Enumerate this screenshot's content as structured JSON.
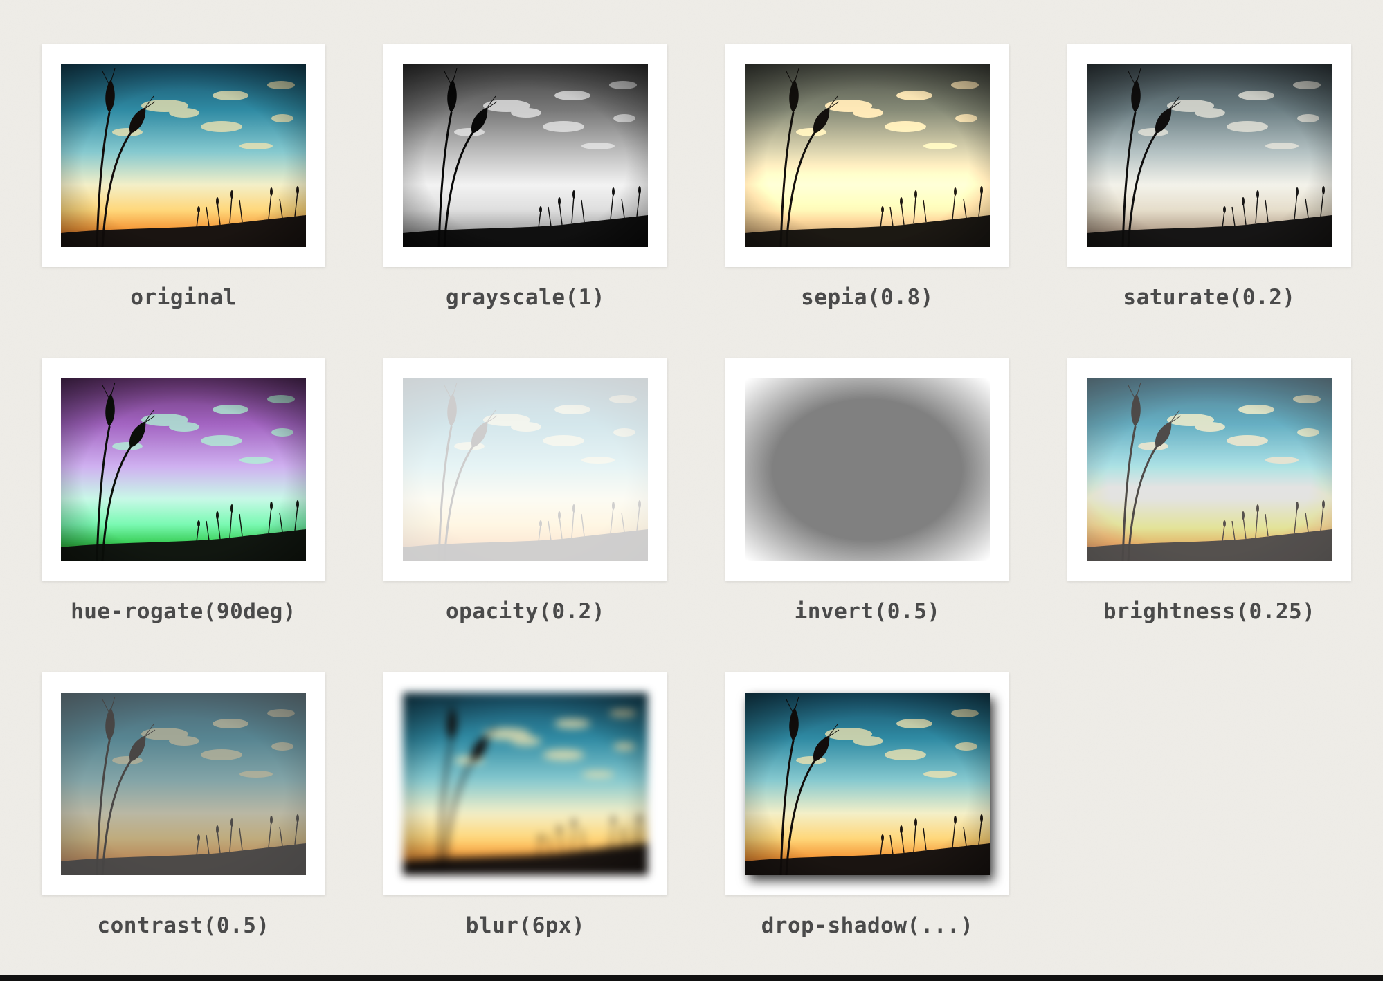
{
  "gallery": {
    "items": [
      {
        "label": "original",
        "filter": "none"
      },
      {
        "label": "grayscale(1)",
        "filter": "grayscale"
      },
      {
        "label": "sepia(0.8)",
        "filter": "sepia"
      },
      {
        "label": "saturate(0.2)",
        "filter": "saturate"
      },
      {
        "label": "hue-rogate(90deg)",
        "filter": "hue-rotate"
      },
      {
        "label": "opacity(0.2)",
        "filter": "opacity"
      },
      {
        "label": "invert(0.5)",
        "filter": "invert"
      },
      {
        "label": "brightness(0.25)",
        "filter": "brightness"
      },
      {
        "label": "contrast(0.5)",
        "filter": "contrast"
      },
      {
        "label": "blur(6px)",
        "filter": "blur"
      },
      {
        "label": "drop-shadow(...)",
        "filter": "drop-shadow"
      }
    ]
  },
  "colors": {
    "background": "#efede8",
    "frame": "#ffffff",
    "caption": "#4a4a4a",
    "bottom_bar": "#111111",
    "sky_top": "#1f5f78",
    "sky_mid": "#7fc3cf",
    "horizon": "#ffe59a",
    "sunset": "#f08a2e"
  },
  "icons": [
    "wheat-silhouette-photo"
  ]
}
